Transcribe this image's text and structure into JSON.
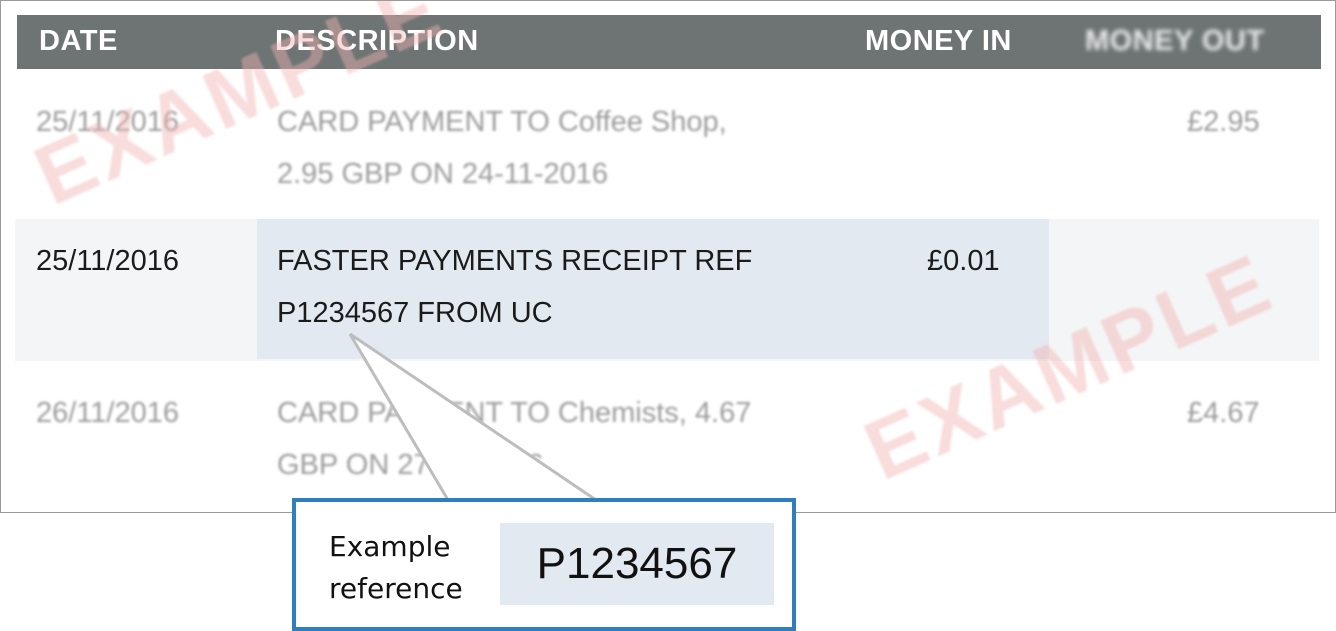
{
  "table": {
    "headers": {
      "date": "DATE",
      "description": "DESCRIPTION",
      "money_in": "MONEY IN",
      "money_out": "MONEY OUT"
    },
    "rows": [
      {
        "date": "25/11/2016",
        "description_line1": "CARD PAYMENT TO Coffee Shop,",
        "description_line2": "2.95 GBP ON 24-11-2016",
        "money_in": "",
        "money_out": "£2.95",
        "state": "blurred"
      },
      {
        "date": "25/11/2016",
        "description_line1": "FASTER PAYMENTS RECEIPT REF",
        "description_line2": "P1234567 FROM UC",
        "money_in": "£0.01",
        "money_out": "",
        "state": "highlighted"
      },
      {
        "date": "26/11/2016",
        "description_line1": "CARD PAYMENT TO Chemists, 4.67",
        "description_line2": "GBP ON 27-11-2016",
        "money_in": "",
        "money_out": "£4.67",
        "state": "blurred"
      }
    ]
  },
  "watermarks": [
    "EXAMPLE",
    "EXAMPLE"
  ],
  "callout": {
    "label_line1": "Example",
    "label_line2": "reference",
    "reference": "P1234567"
  },
  "colors": {
    "header_bg": "#6e7474",
    "highlight_bg": "#e3e9f1",
    "callout_border": "#2f7fbf",
    "watermark": "#f2b3b3"
  }
}
